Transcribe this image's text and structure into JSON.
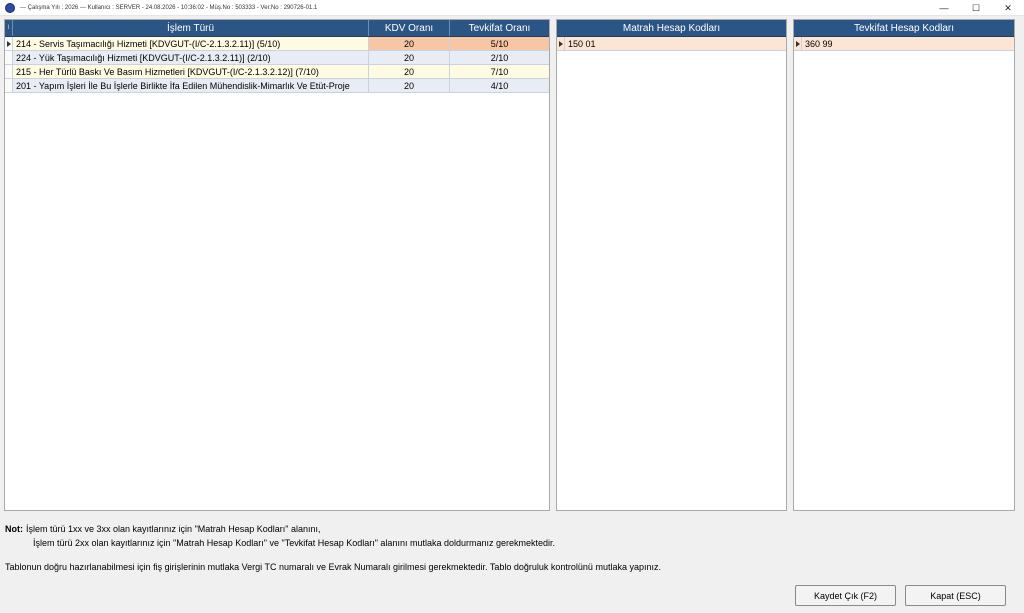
{
  "titlebar": {
    "text": "---  Çalışma Yılı : 2026  ---  Kullanıcı : SERVER - 24.08.2026 - 10:36:02 - Müş.No : 503333 - Ver.No : 290726-01.1",
    "minimize": "—",
    "maximize": "☐",
    "close": "✕"
  },
  "islem_grid": {
    "headers": {
      "indicator": "I",
      "islem_turu": "İşlem Türü",
      "kdv_orani": "KDV Oranı",
      "tevkifat_orani": "Tevkifat Oranı"
    },
    "rows": [
      {
        "islem_turu": "214 - Servis Taşımacılığı Hizmeti [KDVGUT-(I/C-2.1.3.2.11)] (5/10)",
        "kdv_orani": "20",
        "tevkifat_orani": "5/10"
      },
      {
        "islem_turu": "224 - Yük Taşımacılığı Hizmeti [KDVGUT-(I/C-2.1.3.2.11)] (2/10)",
        "kdv_orani": "20",
        "tevkifat_orani": "2/10"
      },
      {
        "islem_turu": "215 - Her Türlü Baskı Ve Basım Hizmetleri [KDVGUT-(I/C-2.1.3.2.12)] (7/10)",
        "kdv_orani": "20",
        "tevkifat_orani": "7/10"
      },
      {
        "islem_turu": "201 - Yapım İşleri İle Bu İşlerle Birlikte İfa Edilen Mühendislik-Mimarlık Ve Etüt-Proje",
        "kdv_orani": "20",
        "tevkifat_orani": "4/10"
      }
    ]
  },
  "matrah_grid": {
    "header": "Matrah Hesap Kodları",
    "rows": [
      {
        "code": "150 01"
      }
    ]
  },
  "tevkifat_grid": {
    "header": "Tevkifat Hesap Kodları",
    "rows": [
      {
        "code": "360 99"
      }
    ]
  },
  "notes": {
    "label": "Not:",
    "line1": "İşlem türü 1xx ve 3xx olan kayıtlarınız için \"Matrah Hesap Kodları\" alanını,",
    "line2": "İşlem türü 2xx olan kayıtlarınız için \"Matrah Hesap Kodları\" ve \"Tevkifat Hesap Kodları\" alanını mutlaka doldurmanız gerekmektedir.",
    "line3": "Tablonun doğru hazırlanabilmesi için fiş girişlerinin mutlaka Vergi TC numaralı ve Evrak Numaralı girilmesi gerekmektedir. Tablo doğruluk kontrolünü mutlaka yapınız."
  },
  "buttons": {
    "save_exit": "Kaydet Çık (F2)",
    "close": "Kapat (ESC)"
  }
}
